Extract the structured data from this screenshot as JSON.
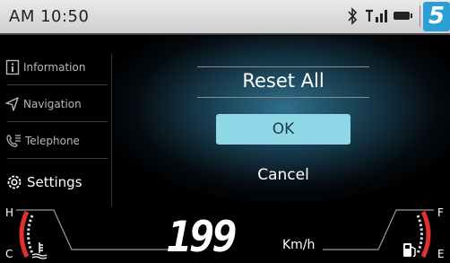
{
  "status": {
    "time": "AM 10:50",
    "gear": "5"
  },
  "sidebar": {
    "items": [
      {
        "label": "Information"
      },
      {
        "label": "Navigation"
      },
      {
        "label": "Telephone"
      },
      {
        "label": "Settings"
      }
    ]
  },
  "dialog": {
    "title": "Reset All",
    "ok": "OK",
    "cancel": "Cancel"
  },
  "cluster": {
    "speed": "199",
    "unit": "Km/h",
    "temp_high": "H",
    "temp_low": "C",
    "fuel_full": "F",
    "fuel_empty": "E"
  },
  "colors": {
    "accent": "#2a9fd6",
    "ok_button": "#8fd6e6",
    "warning_red": "#e03030"
  }
}
